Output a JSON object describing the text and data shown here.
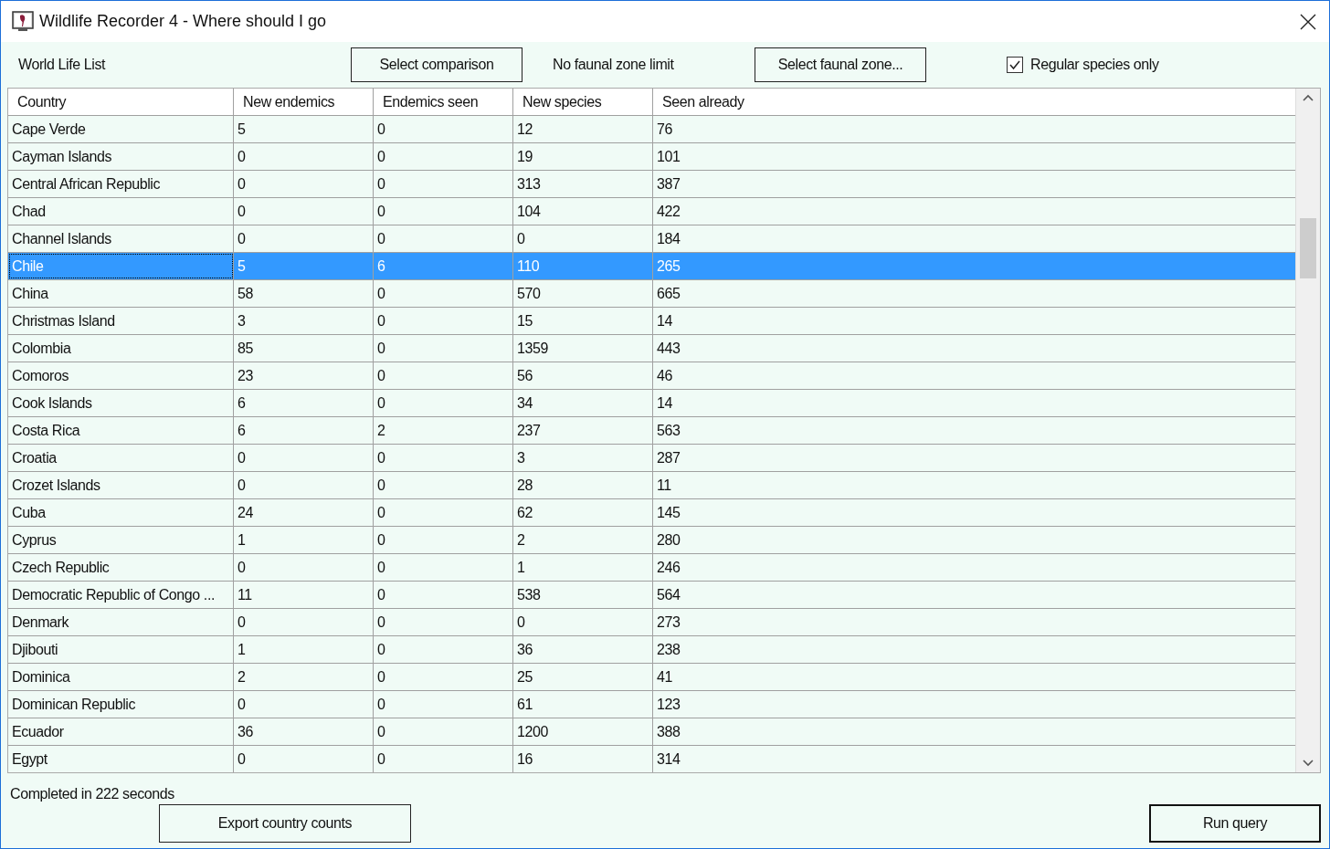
{
  "window": {
    "title": "Wildlife Recorder 4 - Where should I go"
  },
  "toolbar": {
    "list_label": "World Life List",
    "comparison_button": "Select comparison",
    "zone_label": "No faunal zone limit",
    "zone_button": "Select faunal zone...",
    "regular_only": {
      "label": "Regular species only",
      "checked": true
    }
  },
  "table": {
    "columns": [
      "Country",
      "New endemics",
      "Endemics seen",
      "New species",
      "Seen already"
    ],
    "rows": [
      {
        "cells": [
          "Cape Verde",
          "5",
          "0",
          "12",
          "76"
        ],
        "selected": false
      },
      {
        "cells": [
          "Cayman Islands",
          "0",
          "0",
          "19",
          "101"
        ],
        "selected": false
      },
      {
        "cells": [
          "Central African Republic",
          "0",
          "0",
          "313",
          "387"
        ],
        "selected": false
      },
      {
        "cells": [
          "Chad",
          "0",
          "0",
          "104",
          "422"
        ],
        "selected": false
      },
      {
        "cells": [
          "Channel Islands",
          "0",
          "0",
          "0",
          "184"
        ],
        "selected": false
      },
      {
        "cells": [
          "Chile",
          "5",
          "6",
          "110",
          "265"
        ],
        "selected": true
      },
      {
        "cells": [
          "China",
          "58",
          "0",
          "570",
          "665"
        ],
        "selected": false
      },
      {
        "cells": [
          "Christmas Island",
          "3",
          "0",
          "15",
          "14"
        ],
        "selected": false
      },
      {
        "cells": [
          "Colombia",
          "85",
          "0",
          "1359",
          "443"
        ],
        "selected": false
      },
      {
        "cells": [
          "Comoros",
          "23",
          "0",
          "56",
          "46"
        ],
        "selected": false
      },
      {
        "cells": [
          "Cook Islands",
          "6",
          "0",
          "34",
          "14"
        ],
        "selected": false
      },
      {
        "cells": [
          "Costa Rica",
          "6",
          "2",
          "237",
          "563"
        ],
        "selected": false
      },
      {
        "cells": [
          "Croatia",
          "0",
          "0",
          "3",
          "287"
        ],
        "selected": false
      },
      {
        "cells": [
          "Crozet Islands",
          "0",
          "0",
          "28",
          "11"
        ],
        "selected": false
      },
      {
        "cells": [
          "Cuba",
          "24",
          "0",
          "62",
          "145"
        ],
        "selected": false
      },
      {
        "cells": [
          "Cyprus",
          "1",
          "0",
          "2",
          "280"
        ],
        "selected": false
      },
      {
        "cells": [
          "Czech Republic",
          "0",
          "0",
          "1",
          "246"
        ],
        "selected": false
      },
      {
        "cells": [
          "Democratic Republic of Congo ...",
          "11",
          "0",
          "538",
          "564"
        ],
        "selected": false
      },
      {
        "cells": [
          "Denmark",
          "0",
          "0",
          "0",
          "273"
        ],
        "selected": false
      },
      {
        "cells": [
          "Djibouti",
          "1",
          "0",
          "36",
          "238"
        ],
        "selected": false
      },
      {
        "cells": [
          "Dominica",
          "2",
          "0",
          "25",
          "41"
        ],
        "selected": false
      },
      {
        "cells": [
          "Dominican Republic",
          "0",
          "0",
          "61",
          "123"
        ],
        "selected": false
      },
      {
        "cells": [
          "Ecuador",
          "36",
          "0",
          "1200",
          "388"
        ],
        "selected": false
      },
      {
        "cells": [
          "Egypt",
          "0",
          "0",
          "16",
          "314"
        ],
        "selected": false
      }
    ]
  },
  "status": "Completed in 222 seconds",
  "buttons": {
    "export": "Export country counts",
    "run": "Run query"
  }
}
